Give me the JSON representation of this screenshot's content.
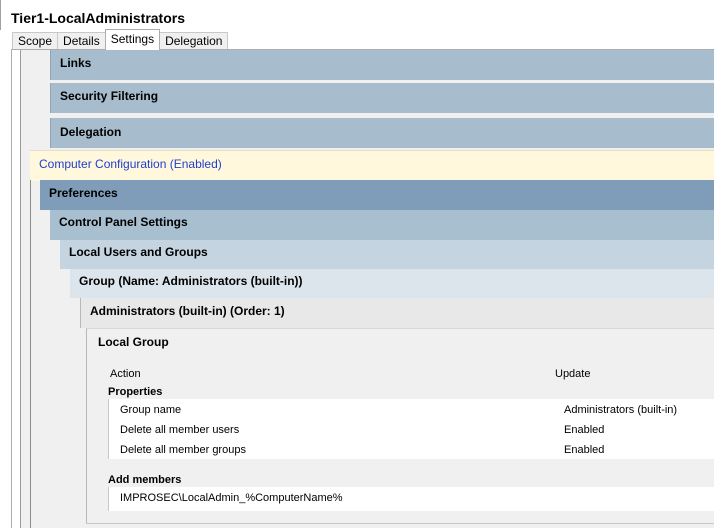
{
  "window": {
    "title": "Tier1-LocalAdministrators"
  },
  "tabs": [
    {
      "label": "Scope"
    },
    {
      "label": "Details"
    },
    {
      "label": "Settings"
    },
    {
      "label": "Delegation"
    }
  ],
  "sections": {
    "links": "Links",
    "security_filtering": "Security Filtering",
    "delegation": "Delegation",
    "computer_config": "Computer Configuration (Enabled)",
    "preferences": "Preferences",
    "control_panel": "Control Panel Settings",
    "local_users_groups": "Local Users and Groups",
    "group": "Group (Name: Administrators (built-in))",
    "admins_order": "Administrators (built-in) (Order: 1)",
    "local_group": "Local Group"
  },
  "details": {
    "action_label": "Action",
    "action_value": "Update",
    "properties_heading": "Properties",
    "properties": [
      {
        "name": "Group name",
        "value": "Administrators (built-in)"
      },
      {
        "name": "Delete all member users",
        "value": "Enabled"
      },
      {
        "name": "Delete all member groups",
        "value": "Enabled"
      }
    ],
    "add_members_heading": "Add members",
    "members": [
      {
        "name": "IMPROSEC\\LocalAdmin_%ComputerName%"
      }
    ]
  },
  "colors": {
    "section_bar": "#a7bccd",
    "preferences_bar": "#7f9db9",
    "control_panel_bar": "#a8bfd0",
    "local_users_bar": "#c4d4e0",
    "group_bar": "#dde5ec",
    "admins_bar": "#e8e8e8",
    "computer_config_bg": "#fff8dc",
    "computer_config_text": "#1f3ecf"
  }
}
